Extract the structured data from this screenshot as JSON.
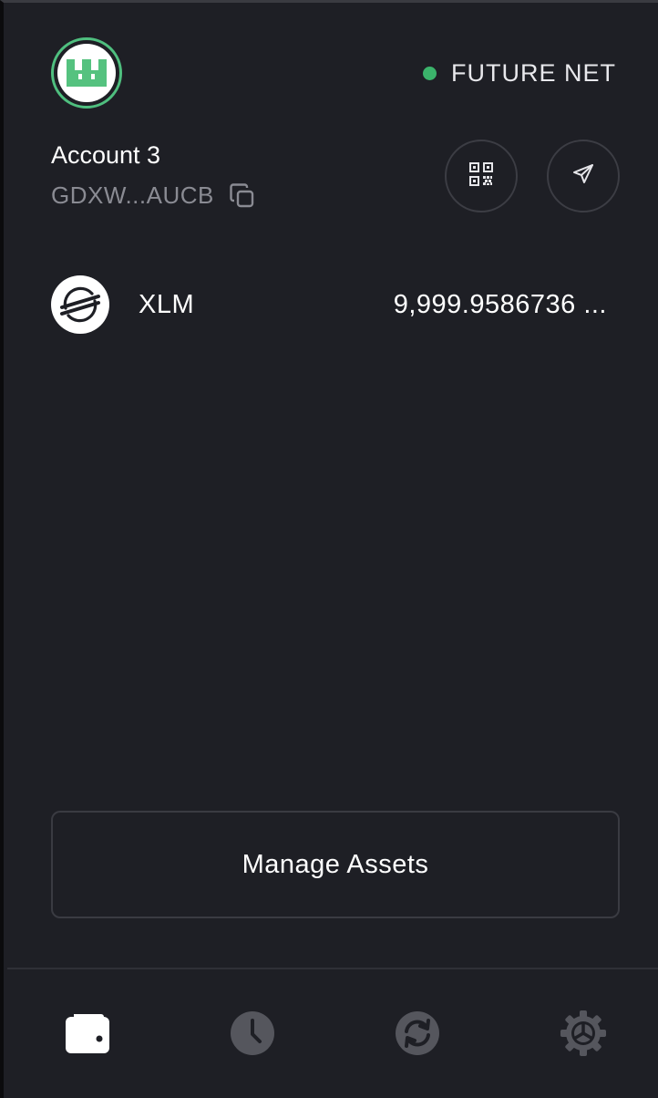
{
  "header": {
    "network_label": "FUTURE NET",
    "network_status_color": "#3bb36b",
    "avatar_icon": "identicon-icon"
  },
  "account": {
    "name": "Account 3",
    "address_short": "GDXW...AUCB",
    "copy_icon": "copy-icon"
  },
  "actions": {
    "receive_icon": "qr-code-icon",
    "send_icon": "send-icon"
  },
  "assets": [
    {
      "code": "XLM",
      "balance": "9,999.9586736 ...",
      "icon": "stellar-logo-icon"
    }
  ],
  "manage_assets_label": "Manage Assets",
  "nav": {
    "items": [
      {
        "icon": "wallet-icon",
        "active": true
      },
      {
        "icon": "clock-icon",
        "active": false
      },
      {
        "icon": "swap-icon",
        "active": false
      },
      {
        "icon": "gear-icon",
        "active": false
      }
    ]
  },
  "colors": {
    "background": "#1e1f25",
    "accent_green": "#4fbf7f",
    "muted_text": "#8a8b93",
    "inactive_icon": "#55565d"
  }
}
